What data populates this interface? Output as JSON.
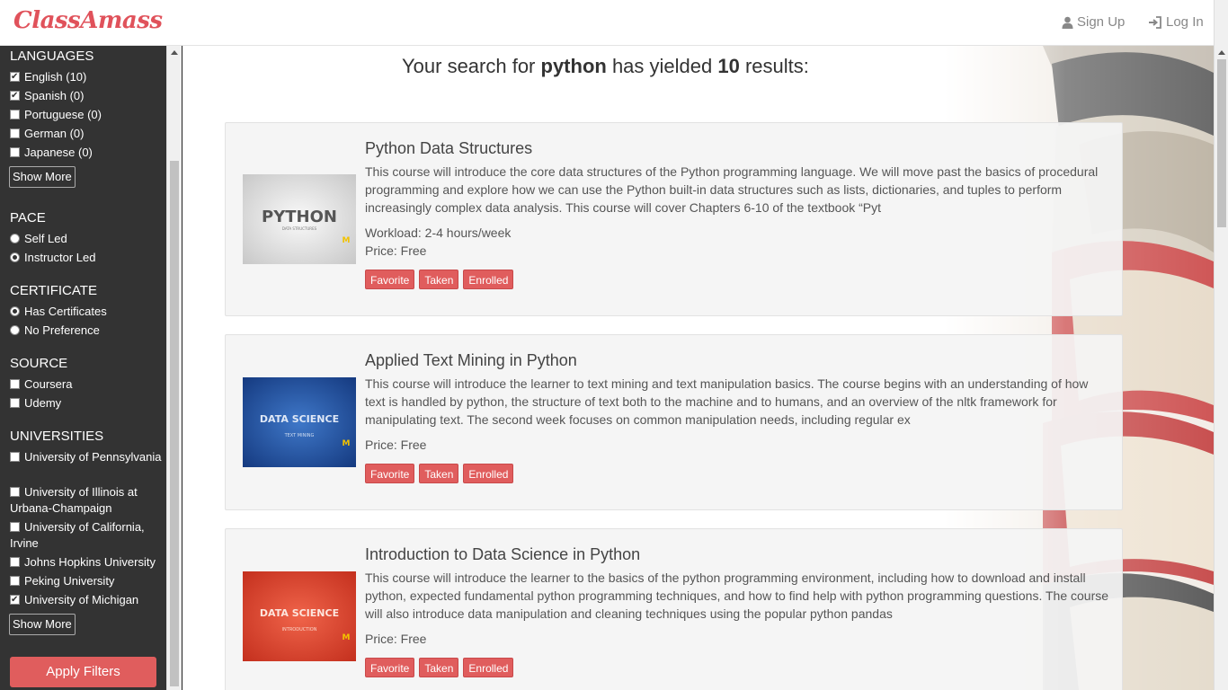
{
  "brand": "ClassAmass",
  "nav": {
    "signup": "Sign Up",
    "login": "Log In"
  },
  "sidebar": {
    "languages": {
      "title": "LANGUAGES",
      "options": [
        {
          "label": "English (10)",
          "checked": true
        },
        {
          "label": "Spanish (0)",
          "checked": true
        },
        {
          "label": "Portuguese (0)",
          "checked": false
        },
        {
          "label": "German (0)",
          "checked": false
        },
        {
          "label": "Japanese (0)",
          "checked": false
        }
      ],
      "show_more": "Show More"
    },
    "pace": {
      "title": "PACE",
      "options": [
        {
          "label": "Self Led",
          "checked": false
        },
        {
          "label": "Instructor Led",
          "checked": true
        }
      ]
    },
    "certificate": {
      "title": "CERTIFICATE",
      "options": [
        {
          "label": "Has Certificates",
          "checked": true
        },
        {
          "label": "No Preference",
          "checked": false
        }
      ]
    },
    "source": {
      "title": "SOURCE",
      "options": [
        {
          "label": "Coursera",
          "checked": false
        },
        {
          "label": "Udemy",
          "checked": false
        }
      ]
    },
    "universities": {
      "title": "UNIVERSITIES",
      "options": [
        {
          "label": "University of Pennsylvania",
          "checked": false
        },
        {
          "label": "University of Illinois at Urbana-Champaign",
          "checked": false
        },
        {
          "label": "University of California, Irvine",
          "checked": false
        },
        {
          "label": "Johns Hopkins University",
          "checked": false
        },
        {
          "label": "Peking University",
          "checked": false
        },
        {
          "label": "University of Michigan",
          "checked": true
        }
      ],
      "show_more": "Show More"
    },
    "apply": "Apply Filters"
  },
  "results": {
    "prefix": "Your search for ",
    "query": "python",
    "middle": " has yielded ",
    "count": "10",
    "suffix": " results:"
  },
  "courses": [
    {
      "title": "Python Data Structures",
      "description": "This course will introduce the core data structures of the Python programming language. We will move past the basics of procedural programming and explore how we can use the Python built-in data structures such as lists, dictionaries, and tuples to perform increasingly complex data analysis. This course will cover Chapters 6-10 of the textbook “Pyt",
      "workload": "Workload: 2-4 hours/week",
      "price": "Price: Free",
      "thumb_title": "PYTHON",
      "thumb_sub": "DATA STRUCTURES",
      "thumb_logo": "M"
    },
    {
      "title": "Applied Text Mining in Python",
      "description": "This course will introduce the learner to text mining and text manipulation basics. The course begins with an understanding of how text is handled by python, the structure of text both to the machine and to humans, and an overview of the nltk framework for manipulating text. The second week focuses on common manipulation needs, including regular ex",
      "price": "Price: Free",
      "thumb_title": "DATA SCIENCE",
      "thumb_sub": "TEXT MINING",
      "thumb_logo": "M"
    },
    {
      "title": "Introduction to Data Science in Python",
      "description": "This course will introduce the learner to the basics of the python programming environment, including how to download and install python, expected fundamental python programming techniques, and how to find help with python programming questions. The course will also introduce data manipulation and cleaning techniques using the popular python pandas",
      "price": "Price: Free",
      "thumb_title": "DATA SCIENCE",
      "thumb_sub": "INTRODUCTION",
      "thumb_logo": "M"
    }
  ],
  "tags": {
    "favorite": "Favorite",
    "taken": "Taken",
    "enrolled": "Enrolled"
  },
  "colors": {
    "brand": "#e0525b",
    "accent": "#e05d5d",
    "sidebar": "#333333"
  }
}
